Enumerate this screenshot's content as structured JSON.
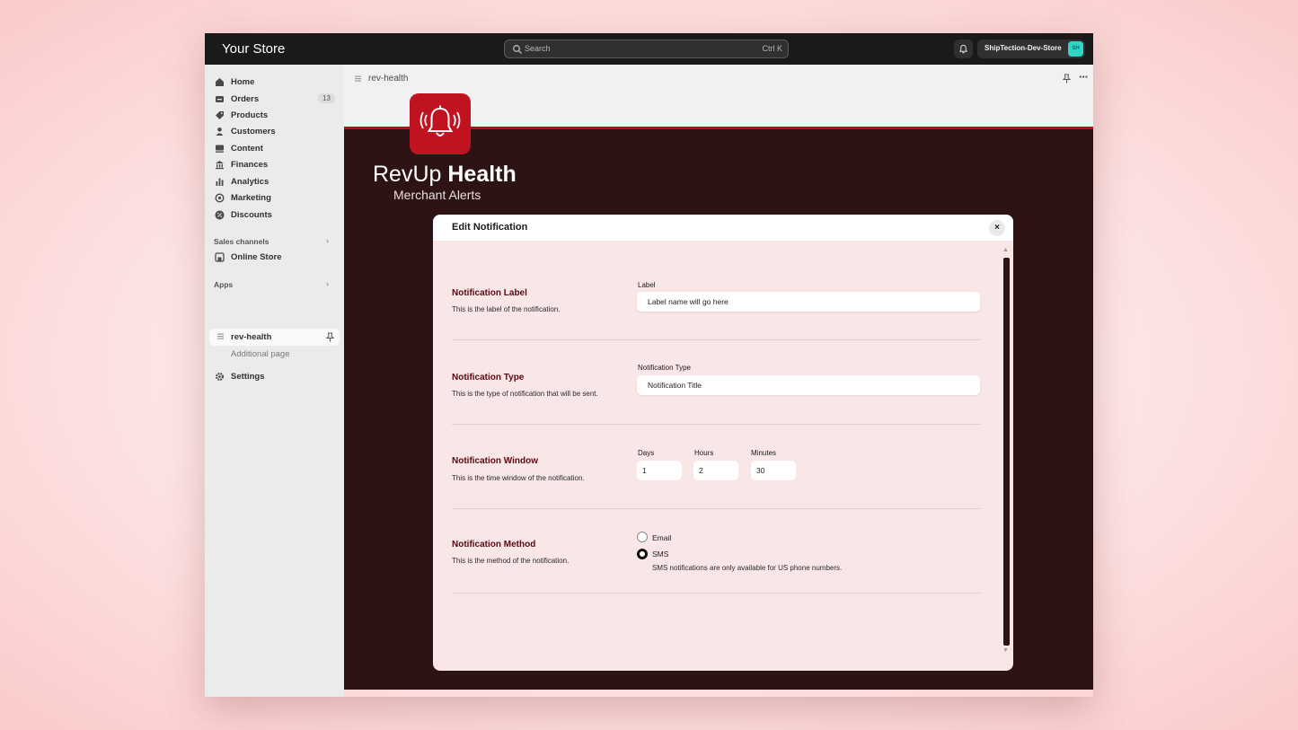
{
  "topbar": {
    "store_title": "Your Store",
    "search_placeholder": "Search",
    "search_shortcut": "Ctrl K",
    "store_name": "ShipTection-Dev-Store",
    "avatar_initials": "SH"
  },
  "sidebar": {
    "items": [
      {
        "label": "Home",
        "icon": "home-icon"
      },
      {
        "label": "Orders",
        "icon": "inbox-icon",
        "badge": "13"
      },
      {
        "label": "Products",
        "icon": "tag-icon"
      },
      {
        "label": "Customers",
        "icon": "person-icon"
      },
      {
        "label": "Content",
        "icon": "content-icon"
      },
      {
        "label": "Finances",
        "icon": "bank-icon"
      },
      {
        "label": "Analytics",
        "icon": "bar-chart-icon"
      },
      {
        "label": "Marketing",
        "icon": "target-icon"
      },
      {
        "label": "Discounts",
        "icon": "discount-icon"
      }
    ],
    "sales_channels_label": "Sales channels",
    "online_store_label": "Online Store",
    "apps_label": "Apps",
    "app_active_label": "rev-health",
    "app_sub_label": "Additional page",
    "settings_label": "Settings"
  },
  "app": {
    "breadcrumb": "rev-health",
    "brand_light": "RevUp ",
    "brand_bold": "Health",
    "brand_sub": "Merchant Alerts"
  },
  "modal": {
    "title": "Edit Notification",
    "close": "×",
    "label_section": {
      "title": "Notification Label",
      "desc": "This is the label of the notification.",
      "field_label": "Label",
      "value": "Label name will go here"
    },
    "type_section": {
      "title": "Notification Type",
      "desc": "This is the type of notification that will be sent.",
      "field_label": "Notification Type",
      "value": "Notification Title"
    },
    "window_section": {
      "title": "Notification Window",
      "desc": "This is the time window of the notification.",
      "days_label": "Days",
      "days_value": "1",
      "hours_label": "Hours",
      "hours_value": "2",
      "minutes_label": "Minutes",
      "minutes_value": "30"
    },
    "method_section": {
      "title": "Notification Method",
      "desc": "This is the method of the notification.",
      "options": [
        {
          "label": "Email",
          "selected": false
        },
        {
          "label": "SMS",
          "selected": true
        }
      ],
      "sms_help": "SMS notifications are only available for US phone numbers."
    }
  },
  "colors": {
    "brand_red": "#c1121f",
    "app_background": "#2e1315",
    "modal_background": "#f9e6e6",
    "section_title": "#5a0a10",
    "avatar": "#30d5c8"
  }
}
